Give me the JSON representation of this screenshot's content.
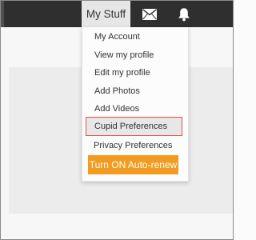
{
  "topbar": {
    "my_stuff_label": "My Stuff",
    "mail_icon": "envelope-icon",
    "notifications_icon": "bell-icon"
  },
  "dropdown": {
    "items": [
      {
        "label": "My Account"
      },
      {
        "label": "View my profile"
      },
      {
        "label": "Edit my profile"
      },
      {
        "label": "Add Photos"
      },
      {
        "label": "Add Videos"
      },
      {
        "label": "Cupid Preferences",
        "highlighted": true
      },
      {
        "label": "Privacy Preferences"
      }
    ],
    "cta_label": "Turn ON Auto-renew"
  },
  "colors": {
    "topbar": "#2f2f2f",
    "my_stuff_bg": "#e6e6e6",
    "cta": "#f29b1f",
    "highlight_border": "#d9534f"
  }
}
